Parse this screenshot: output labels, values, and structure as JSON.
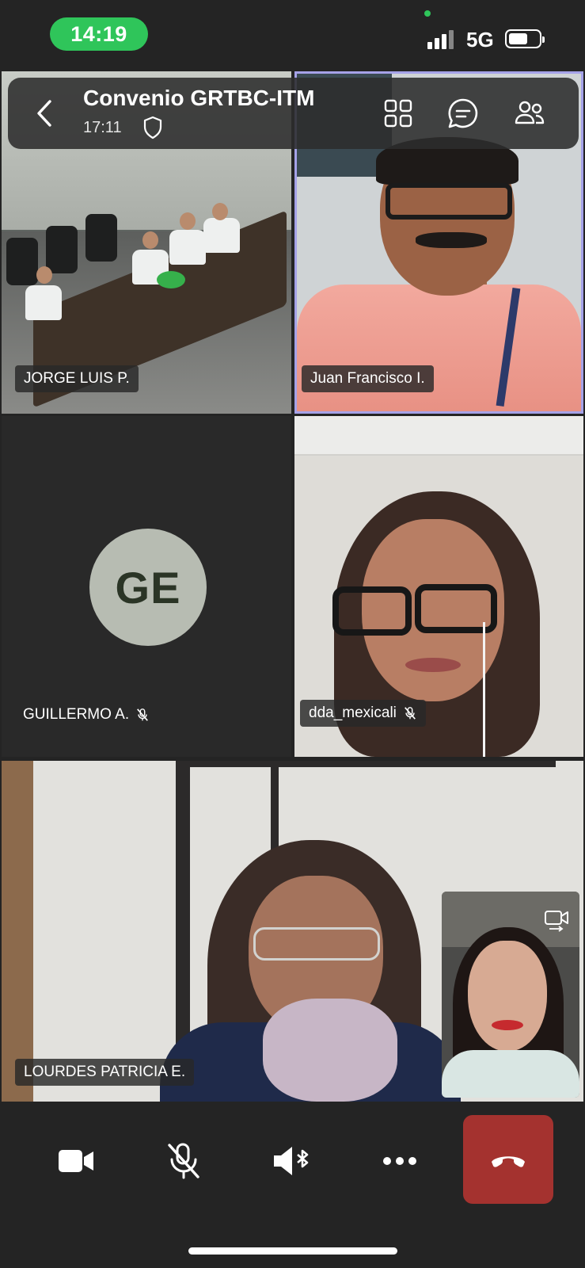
{
  "status_bar": {
    "time": "14:19",
    "network": "5G",
    "battery_level": 0.65
  },
  "header": {
    "title": "Convenio GRTBC-ITM",
    "duration": "17:11",
    "icons": [
      "chevron-left-icon",
      "shield-icon",
      "grid-icon",
      "chat-icon",
      "participants-icon"
    ]
  },
  "participants": [
    {
      "name": "JORGE LUIS P.",
      "muted": false
    },
    {
      "name": "Juan Francisco I.",
      "muted": false,
      "speaking": true
    },
    {
      "name": "GUILLERMO A.",
      "muted": true,
      "initials": "GE"
    },
    {
      "name": "dda_mexicali",
      "muted": true
    },
    {
      "name": "LOURDES PATRICIA E.",
      "muted": false
    }
  ],
  "controls": [
    "camera-icon",
    "mic-off-icon",
    "speaker-icon",
    "more-icon",
    "end-call-icon"
  ],
  "colors": {
    "time_pill": "#2fc55a",
    "end_call": "#a4322f",
    "active_speaker_border": "#a5a2e8",
    "avatar_bg": "#b7bcb2",
    "background": "#242424"
  }
}
